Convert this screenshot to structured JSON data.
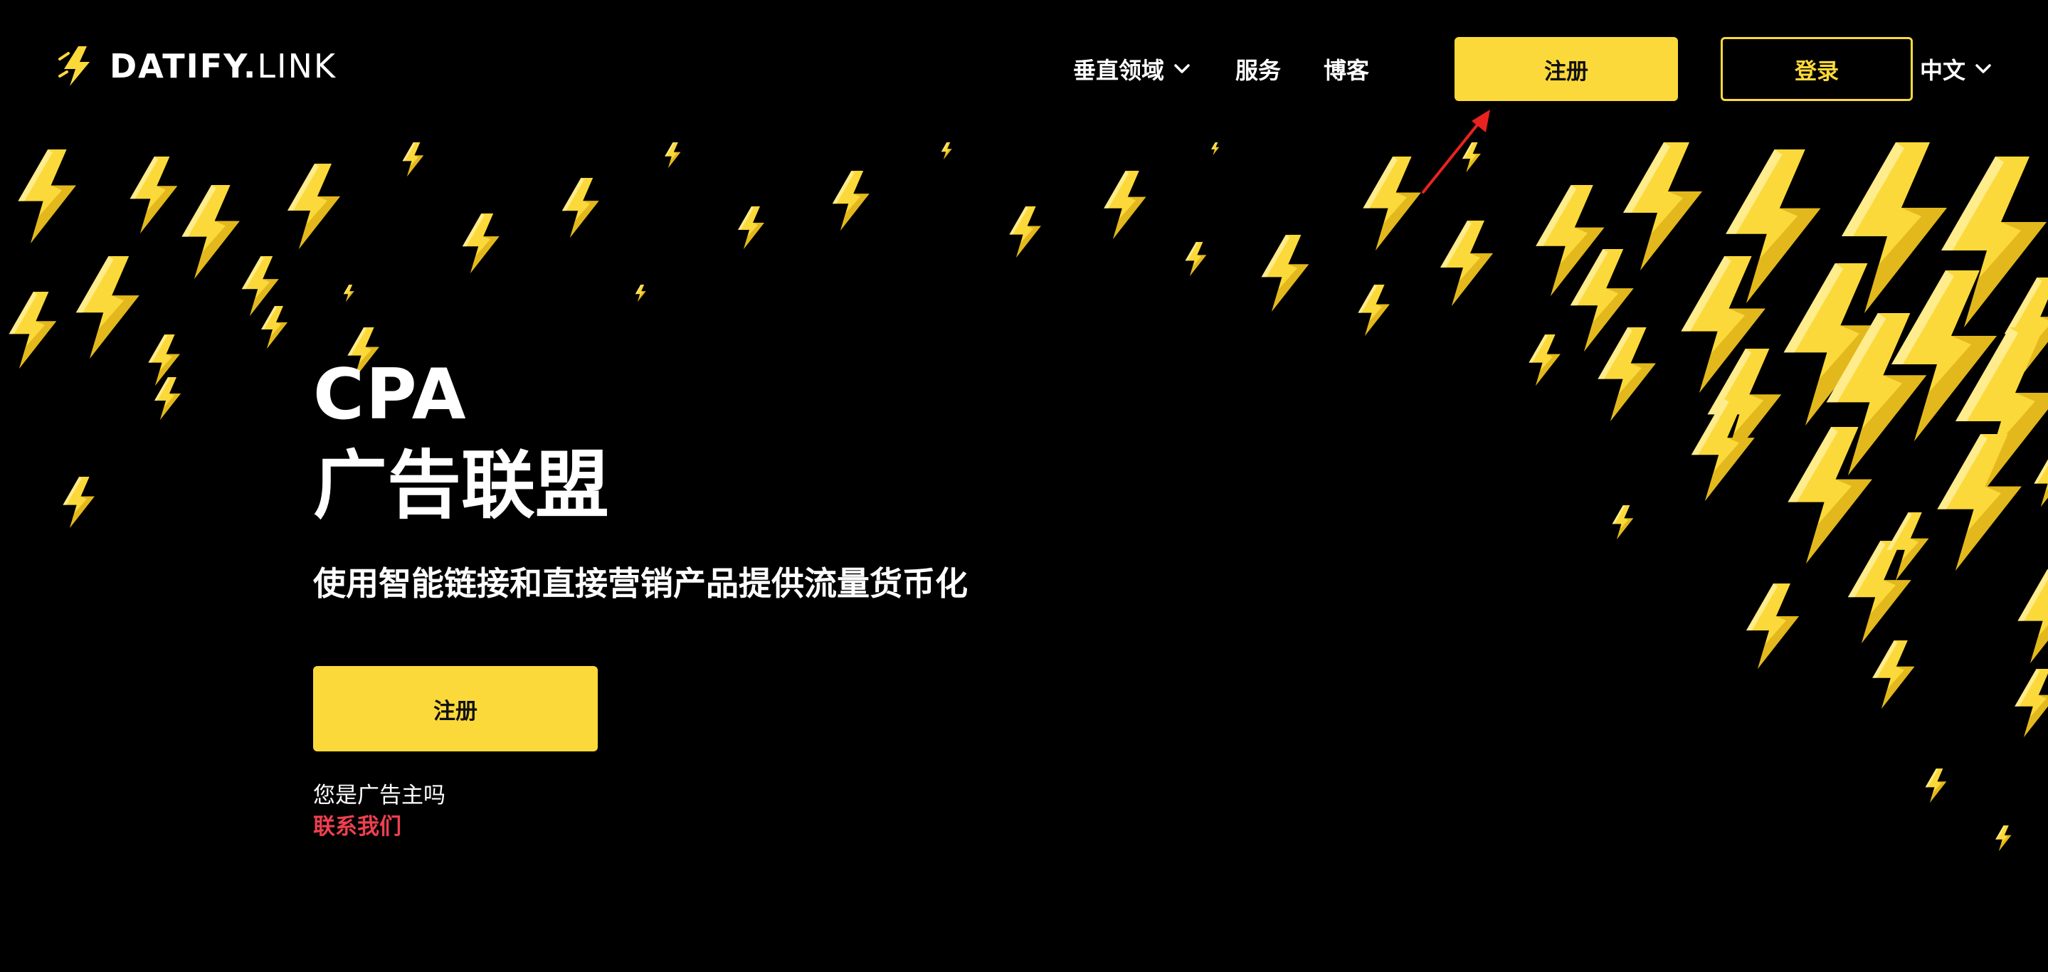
{
  "brand": {
    "name_bold": "DATIFY.",
    "name_thin": "LINK",
    "accent_color": "#fcd93a",
    "link_color": "#ef3f4f"
  },
  "nav": {
    "items": [
      {
        "label": "垂直领域",
        "icon": "chevron-down-icon"
      },
      {
        "label": "服务"
      },
      {
        "label": "博客"
      }
    ],
    "register_label": "注册",
    "login_label": "登录",
    "language_label": "中文"
  },
  "hero": {
    "title_line1": "CPA",
    "title_line2": "广告联盟",
    "subtitle": "使用智能链接和直接营销产品提供流量货币化",
    "register_label": "注册",
    "advertiser_question": "您是广告主吗",
    "contact_link": "联系我们"
  }
}
